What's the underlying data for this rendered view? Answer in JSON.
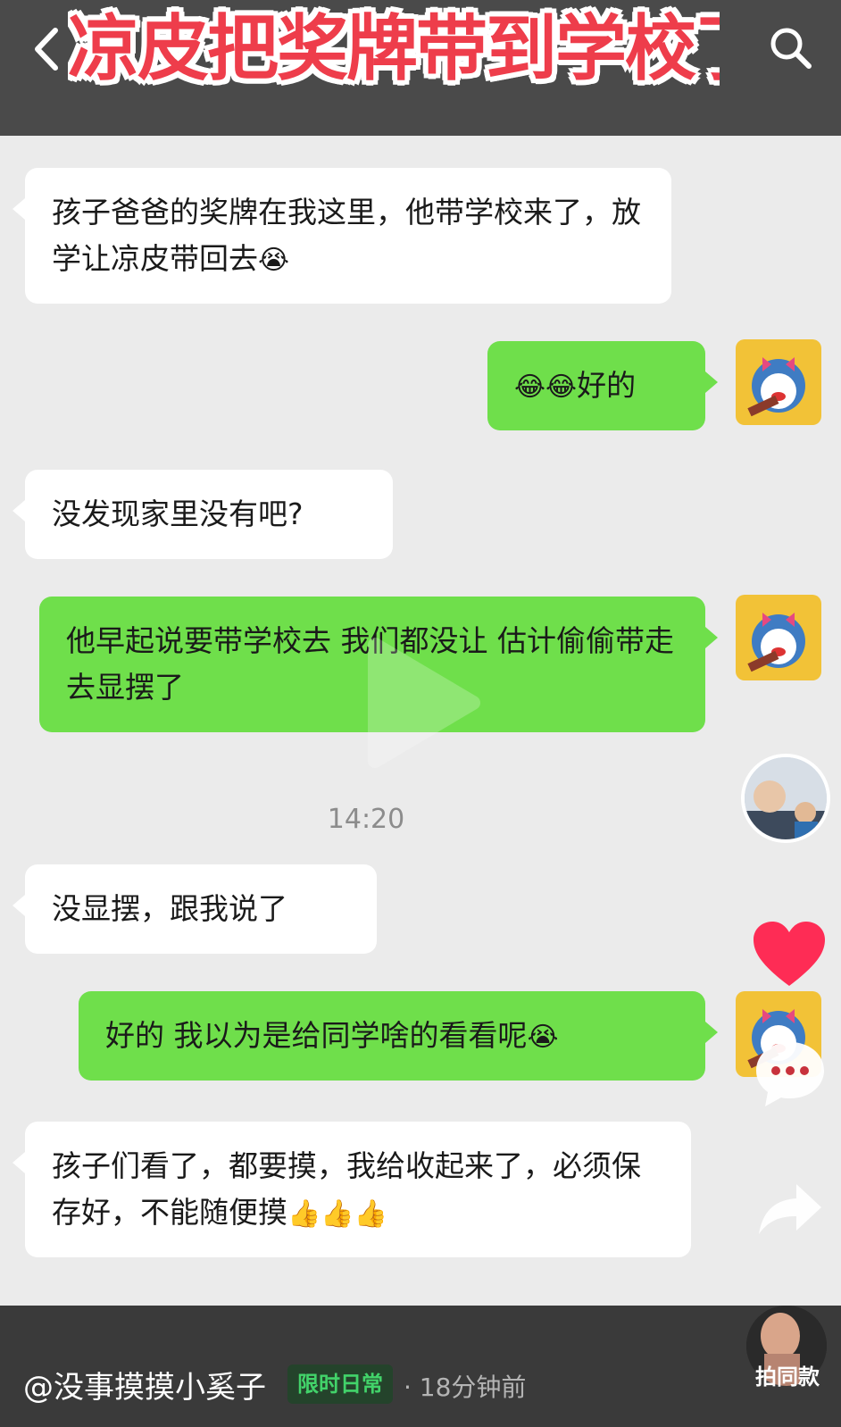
{
  "header": {
    "title": "凉皮把奖牌带到学校了"
  },
  "messages": [
    {
      "side": "in",
      "text": "孩子爸爸的奖牌在我这里，他带学校来了，放学让凉皮带回去",
      "emoji": "😭"
    },
    {
      "side": "out",
      "emoji_prefix": "😂😂",
      "text": "好的"
    },
    {
      "side": "in",
      "text": "没发现家里没有吧?"
    },
    {
      "side": "out",
      "text": "他早起说要带学校去 我们都没让 估计偷偷带走 去显摆了"
    },
    {
      "side": "in",
      "text": "没显摆，跟我说了"
    },
    {
      "side": "out",
      "text": "好的 我以为是给同学啥的看看呢",
      "emoji": "😭"
    },
    {
      "side": "in",
      "text": "孩子们看了，都要摸，我给收起来了，必须保存好，不能随便摸",
      "emoji": "👍👍👍"
    }
  ],
  "timestamp": "14:20",
  "footer": {
    "author": "@没事摸摸小奚子",
    "tag": "限时日常",
    "time_ago": "· 18分钟前",
    "same_style": "拍同款"
  },
  "icons": {
    "back": "chevron-left-icon",
    "search": "search-icon",
    "play": "play-icon",
    "like": "heart-icon",
    "comment": "comment-icon",
    "share": "share-icon"
  },
  "colors": {
    "incoming_bubble": "#ffffff",
    "outgoing_bubble": "#6fdf4b",
    "like": "#fe2c55",
    "tag_text": "#42d36a"
  }
}
